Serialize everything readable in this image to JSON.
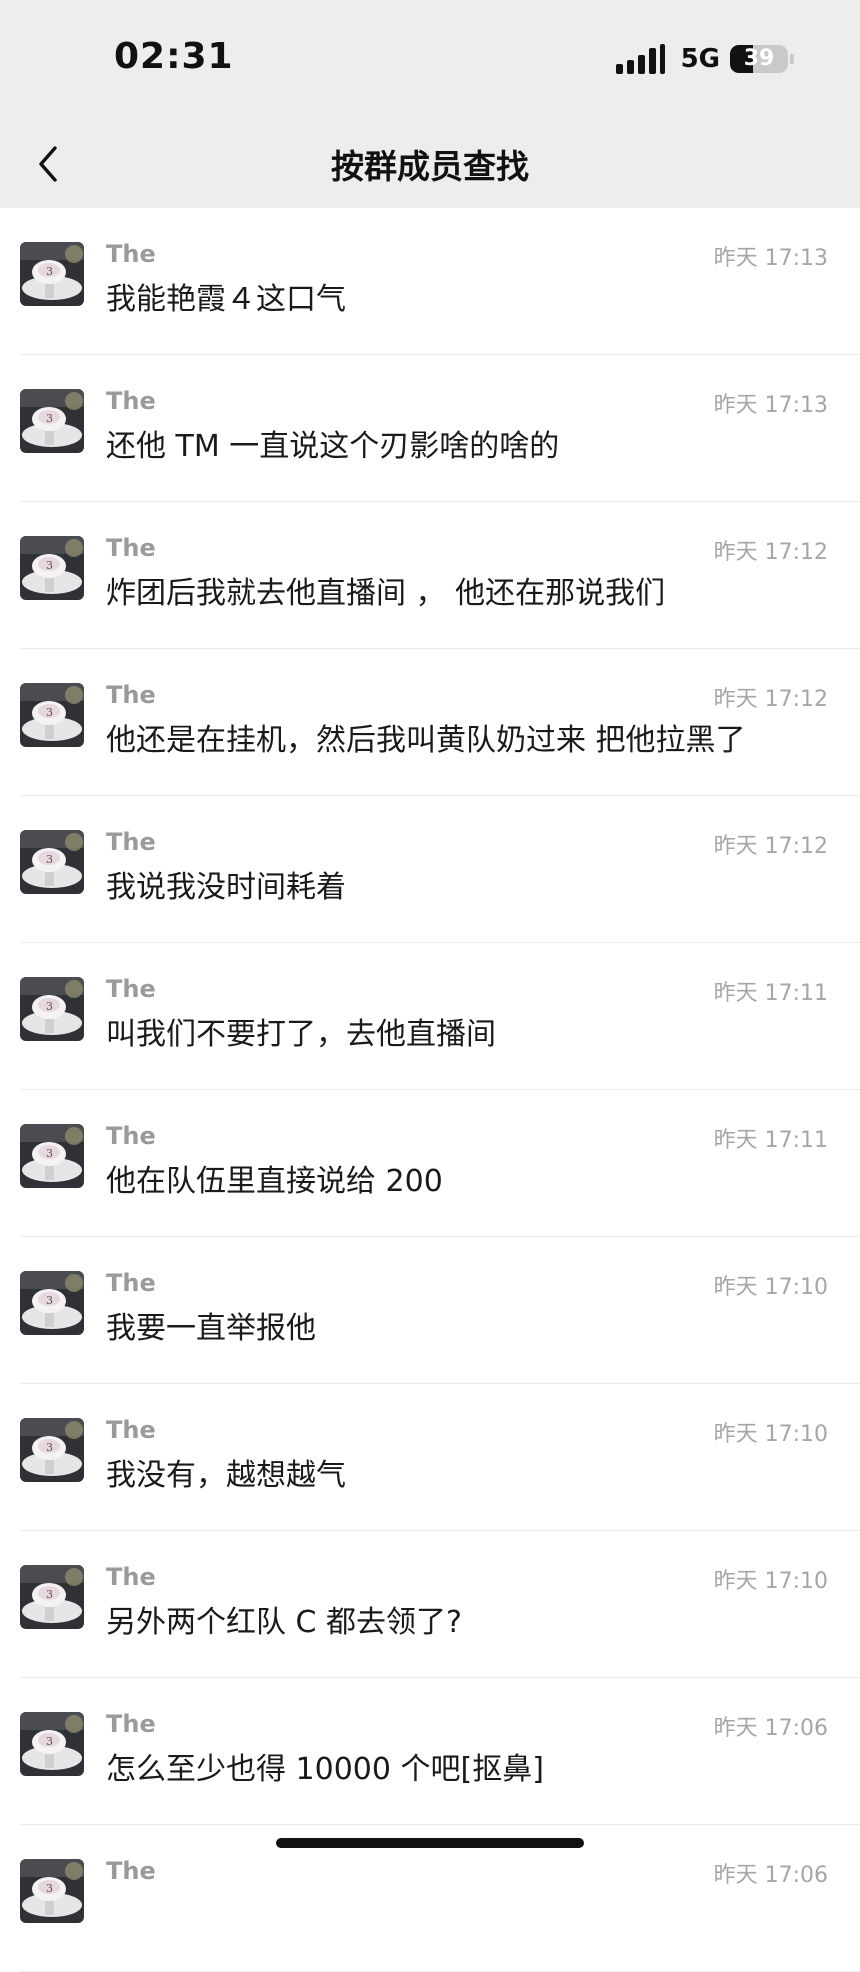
{
  "status_bar": {
    "time": "02:31",
    "network": "5G",
    "battery": "39",
    "battery_level": 0.39
  },
  "nav": {
    "title": "按群成员查找"
  },
  "messages": [
    {
      "name": "The",
      "time": "昨天 17:13",
      "text": "我能艳霞４这口气"
    },
    {
      "name": "The",
      "time": "昨天 17:13",
      "text": "还他 TM 一直说这个刃影啥的啥的"
    },
    {
      "name": "The",
      "time": "昨天 17:12",
      "text": "炸团后我就去他直播间 ， 他还在那说我们"
    },
    {
      "name": "The",
      "time": "昨天 17:12",
      "text": "他还是在挂机，然后我叫黄队奶过来 把他拉黑了"
    },
    {
      "name": "The",
      "time": "昨天 17:12",
      "text": "我说我没时间耗着"
    },
    {
      "name": "The",
      "time": "昨天 17:11",
      "text": "叫我们不要打了，去他直播间"
    },
    {
      "name": "The",
      "time": "昨天 17:11",
      "text": "他在队伍里直接说给 200"
    },
    {
      "name": "The",
      "time": "昨天 17:10",
      "text": "我要一直举报他"
    },
    {
      "name": "The",
      "time": "昨天 17:10",
      "text": "我没有，越想越气"
    },
    {
      "name": "The",
      "time": "昨天 17:10",
      "text": "另外两个红队 C 都去领了?"
    },
    {
      "name": "The",
      "time": "昨天 17:06",
      "text": "怎么至少也得 10000 个吧[抠鼻]"
    },
    {
      "name": "The",
      "time": "昨天 17:06",
      "text": ""
    }
  ]
}
